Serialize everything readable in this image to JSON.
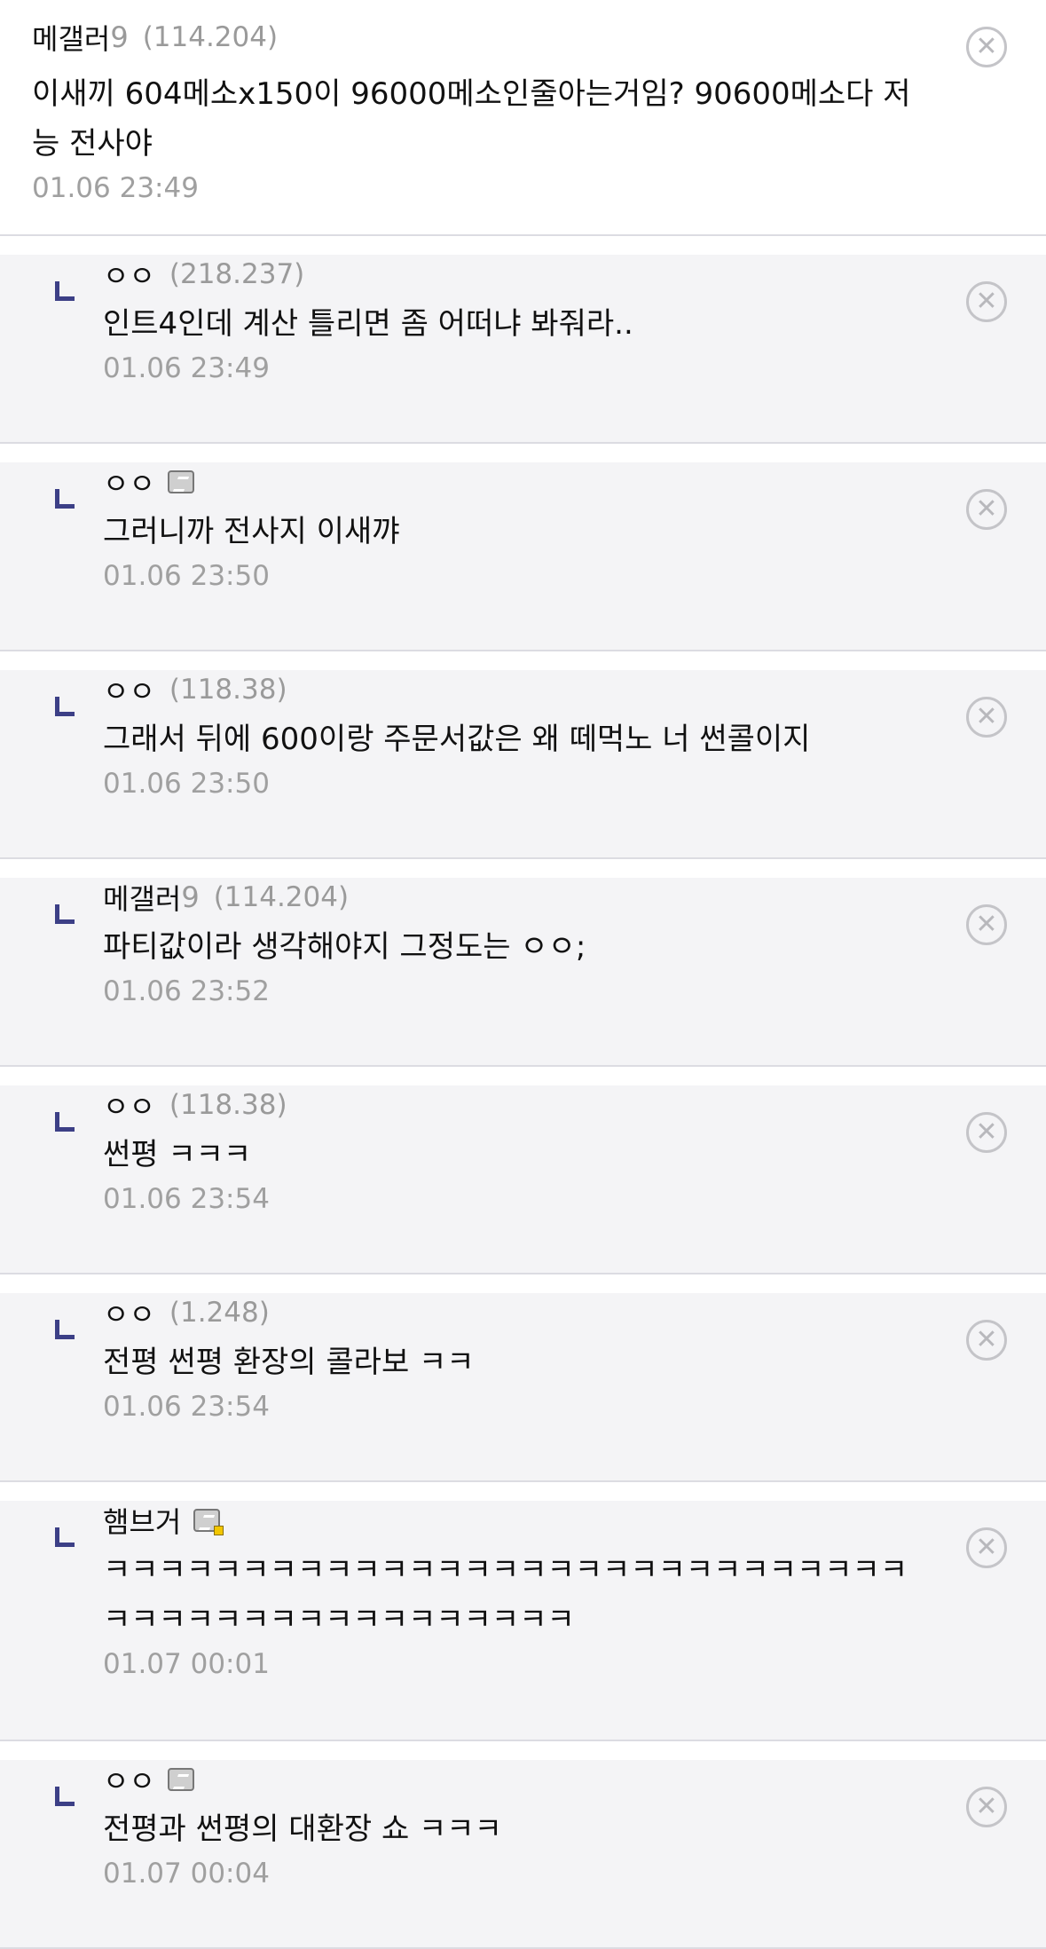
{
  "comments": [
    {
      "nick": "메갤러",
      "nick_suffix": "9",
      "ip": "(114.204)",
      "text": "이새끼 604메소x150이 96000메소인줄아는거임? 90600메소다 저능 전사야",
      "time": "01.06 23:49"
    }
  ],
  "replies": [
    {
      "nick": "ㅇㅇ",
      "nick_suffix": "",
      "ip": "(218.237)",
      "badge": "",
      "text": "인트4인데 계산 틀리면 좀 어떠냐 봐줘라..",
      "time": "01.06 23:49"
    },
    {
      "nick": "ㅇㅇ",
      "nick_suffix": "",
      "ip": "",
      "badge": "fixed-nick-icon",
      "text": "그러니까 전사지 이새꺄",
      "time": "01.06 23:50"
    },
    {
      "nick": "ㅇㅇ",
      "nick_suffix": "",
      "ip": "(118.38)",
      "badge": "",
      "text": "그래서 뒤에 600이랑 주문서값은 왜 떼먹노 너 썬콜이지",
      "time": "01.06 23:50"
    },
    {
      "nick": "메갤러",
      "nick_suffix": "9",
      "ip": "(114.204)",
      "badge": "",
      "text": "파티값이라 생각해야지 그정도는 ㅇㅇ;",
      "time": "01.06 23:52"
    },
    {
      "nick": "ㅇㅇ",
      "nick_suffix": "",
      "ip": "(118.38)",
      "badge": "",
      "text": "썬평 ㅋㅋㅋ",
      "time": "01.06 23:54"
    },
    {
      "nick": "ㅇㅇ",
      "nick_suffix": "",
      "ip": "(1.248)",
      "badge": "",
      "text": "전평 썬평 환장의 콜라보 ㅋㅋ",
      "time": "01.06 23:54"
    },
    {
      "nick": "햄브거",
      "nick_suffix": "",
      "ip": "",
      "badge": "fixed-nick-gold-icon",
      "text": "ㅋㅋㅋㅋㅋㅋㅋㅋㅋㅋㅋㅋㅋㅋㅋㅋㅋㅋㅋㅋㅋㅋㅋㅋㅋㅋㅋㅋㅋㅋㅋㅋㅋㅋㅋㅋㅋㅋㅋㅋㅋㅋㅋㅋㅋㅋ",
      "time": "01.07 00:01"
    },
    {
      "nick": "ㅇㅇ",
      "nick_suffix": "",
      "ip": "",
      "badge": "fixed-nick-icon",
      "text": "전평과 썬평의 대환장 쇼 ㅋㅋㅋ",
      "time": "01.07 00:04"
    }
  ],
  "icons": {
    "close": "close-circle-icon",
    "reply": "reply-arrow-icon"
  },
  "colors": {
    "reply_marker": "#3c3f86",
    "reply_background": "#f4f4f6",
    "meta_gray": "#9a9a9a"
  }
}
